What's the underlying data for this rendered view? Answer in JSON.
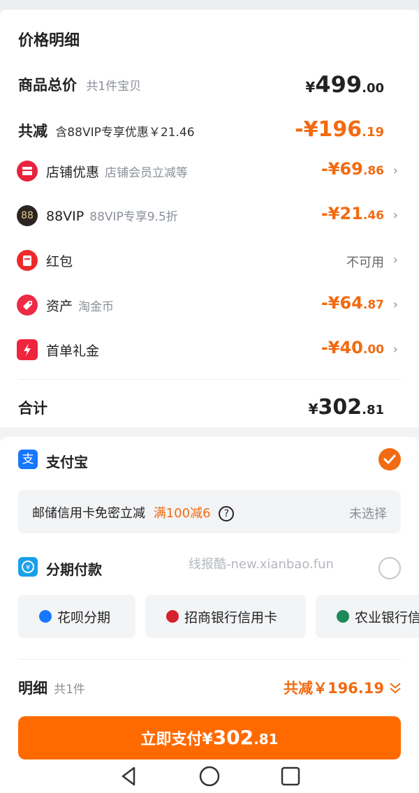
{
  "price_detail": {
    "title": "价格明细",
    "total_label": "商品总价",
    "total_sub": "共1件宝贝",
    "total_int": "499",
    "total_dec": ".00",
    "discount_label": "共减",
    "discount_sub": "含88VIP专享优惠￥21.46",
    "discount_int": "-¥196",
    "discount_dec": ".19",
    "currency": "¥",
    "items": [
      {
        "label": "店铺优惠",
        "sub": "店铺会员立减等",
        "amount_int": "-¥69",
        "amount_dec": ".86",
        "icon": "store-icon",
        "color": "#e8233e"
      },
      {
        "label": "88VIP",
        "sub": "88VIP专享9.5折",
        "amount_int": "-¥21",
        "amount_dec": ".46",
        "icon": "vip88-icon",
        "color": "#2a2520"
      },
      {
        "label": "红包",
        "sub": "",
        "amount_int": "",
        "amount_dec": "",
        "status": "不可用",
        "icon": "red-packet-icon",
        "color": "#ee2a2a"
      },
      {
        "label": "资产",
        "sub": "淘金币",
        "amount_int": "-¥64",
        "amount_dec": ".87",
        "icon": "coin-tag-icon",
        "color": "#ee2a44"
      },
      {
        "label": "首单礼金",
        "sub": "",
        "amount_int": "-¥40",
        "amount_dec": ".00",
        "icon": "first-order-gift-icon",
        "color": "#f0243c"
      }
    ],
    "sum_label": "合计",
    "sum_int": "302",
    "sum_dec": ".81"
  },
  "payment": {
    "alipay_label": "支付宝",
    "alipay_icon_char": "支",
    "promo_text": "邮储信用卡免密立减",
    "promo_highlight": "满100减6",
    "promo_status": "未选择",
    "installment_label": "分期付款",
    "watermark": "线报酷-new.xianbao.fun",
    "methods": [
      {
        "label": "花呗分期",
        "icon": "huabei-icon",
        "color": "#1677ff"
      },
      {
        "label": "招商银行信用卡",
        "icon": "cmb-bank-icon",
        "color": "#d6222a"
      },
      {
        "label": "农业银行信",
        "icon": "abc-bank-icon",
        "color": "#1d8a5a"
      }
    ]
  },
  "footer": {
    "detail_label": "明细",
    "detail_count": "共1件",
    "discount_summary": "共减￥196.19",
    "pay_prefix": "立即支付¥",
    "pay_int": "302",
    "pay_dec": ".81"
  },
  "colors": {
    "accent": "#f26a11",
    "pay_button": "#ff6a00",
    "alipay": "#1677ff"
  }
}
